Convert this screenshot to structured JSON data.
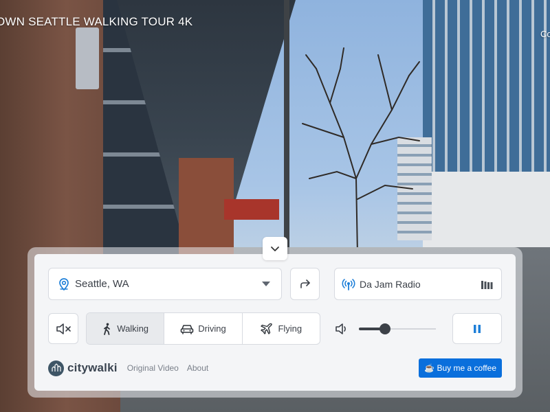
{
  "video": {
    "title": "OWN SEATTLE WALKING TOUR 4K",
    "corner_text": "Co"
  },
  "panel": {
    "collapse_icon": "chevron-down-icon",
    "location": {
      "value": "Seattle, WA",
      "icon": "map-pin-icon"
    },
    "swap_icon": "share-arrow-icon",
    "radio": {
      "label": "Da Jam Radio",
      "icon": "broadcast-icon",
      "level_icon": "equalizer-bars-icon"
    },
    "mute_icon": "volume-mute-icon",
    "modes": [
      {
        "label": "Walking",
        "icon": "walking-person-icon",
        "active": true
      },
      {
        "label": "Driving",
        "icon": "car-icon",
        "active": false
      },
      {
        "label": "Flying",
        "icon": "airplane-icon",
        "active": false
      }
    ],
    "volume": {
      "icon": "speaker-icon",
      "level": 0.34
    },
    "pause_icon": "pause-icon"
  },
  "footer": {
    "brand": "citywalki",
    "links": [
      "Original Video",
      "About"
    ],
    "coffee_label": "☕ Buy me a coffee"
  },
  "colors": {
    "accent": "#0a6fdc",
    "pin_blue": "#1e7fd8",
    "text_dark": "#3a3f47"
  }
}
